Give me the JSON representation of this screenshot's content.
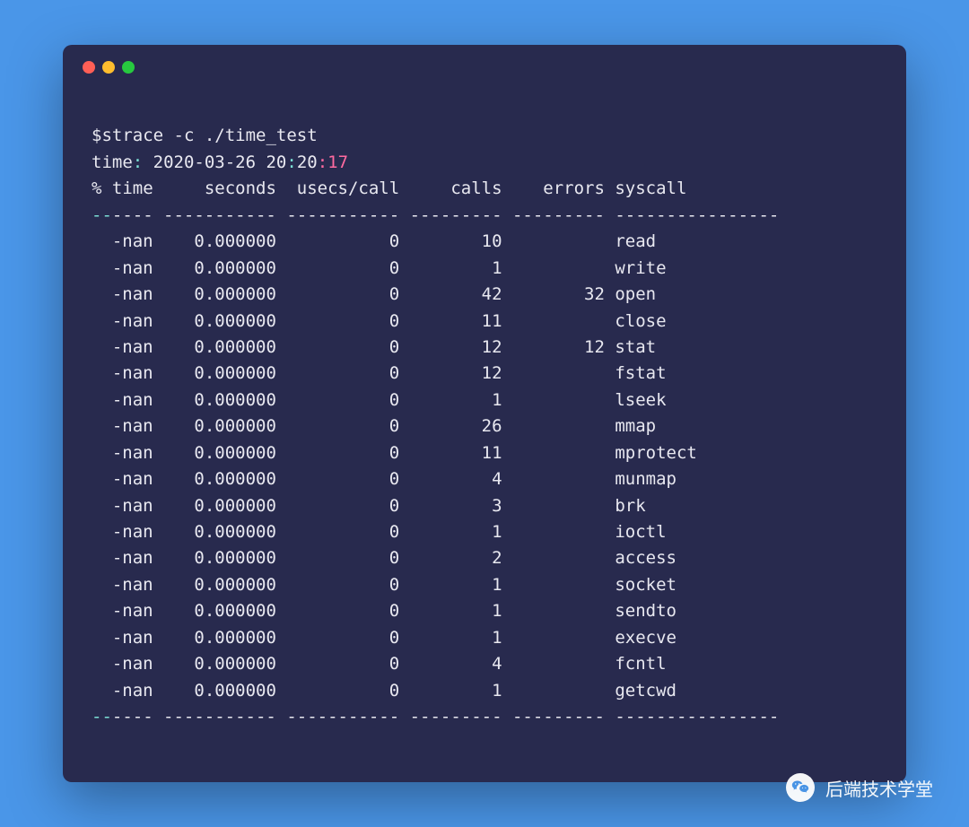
{
  "titlebar": {
    "dots": [
      "close",
      "minimize",
      "zoom"
    ]
  },
  "prompt": "$strace -c ./time_test",
  "time_label": "time",
  "time_sep1": ": ",
  "timestamp_date": "2020-03-26 20",
  "time_sep2": ":",
  "timestamp_min": "20",
  "time_sep3": ":",
  "timestamp_sec": "17",
  "columns": {
    "time": "% time",
    "seconds": "seconds",
    "usecs": "usecs/call",
    "calls": "calls",
    "errors": "errors",
    "syscall": "syscall"
  },
  "sep": {
    "time_c1": "--",
    "time_rest": "----",
    "seconds": "-----------",
    "usecs": "-----------",
    "calls": "---------",
    "errors": "---------",
    "syscall": "----------------"
  },
  "rows": [
    {
      "time": "-nan",
      "seconds": "0.000000",
      "usecs": "0",
      "calls": "10",
      "errors": "",
      "syscall": "read"
    },
    {
      "time": "-nan",
      "seconds": "0.000000",
      "usecs": "0",
      "calls": "1",
      "errors": "",
      "syscall": "write"
    },
    {
      "time": "-nan",
      "seconds": "0.000000",
      "usecs": "0",
      "calls": "42",
      "errors": "32",
      "syscall": "open"
    },
    {
      "time": "-nan",
      "seconds": "0.000000",
      "usecs": "0",
      "calls": "11",
      "errors": "",
      "syscall": "close"
    },
    {
      "time": "-nan",
      "seconds": "0.000000",
      "usecs": "0",
      "calls": "12",
      "errors": "12",
      "syscall": "stat"
    },
    {
      "time": "-nan",
      "seconds": "0.000000",
      "usecs": "0",
      "calls": "12",
      "errors": "",
      "syscall": "fstat"
    },
    {
      "time": "-nan",
      "seconds": "0.000000",
      "usecs": "0",
      "calls": "1",
      "errors": "",
      "syscall": "lseek"
    },
    {
      "time": "-nan",
      "seconds": "0.000000",
      "usecs": "0",
      "calls": "26",
      "errors": "",
      "syscall": "mmap"
    },
    {
      "time": "-nan",
      "seconds": "0.000000",
      "usecs": "0",
      "calls": "11",
      "errors": "",
      "syscall": "mprotect"
    },
    {
      "time": "-nan",
      "seconds": "0.000000",
      "usecs": "0",
      "calls": "4",
      "errors": "",
      "syscall": "munmap"
    },
    {
      "time": "-nan",
      "seconds": "0.000000",
      "usecs": "0",
      "calls": "3",
      "errors": "",
      "syscall": "brk"
    },
    {
      "time": "-nan",
      "seconds": "0.000000",
      "usecs": "0",
      "calls": "1",
      "errors": "",
      "syscall": "ioctl"
    },
    {
      "time": "-nan",
      "seconds": "0.000000",
      "usecs": "0",
      "calls": "2",
      "errors": "",
      "syscall": "access"
    },
    {
      "time": "-nan",
      "seconds": "0.000000",
      "usecs": "0",
      "calls": "1",
      "errors": "",
      "syscall": "socket"
    },
    {
      "time": "-nan",
      "seconds": "0.000000",
      "usecs": "0",
      "calls": "1",
      "errors": "",
      "syscall": "sendto"
    },
    {
      "time": "-nan",
      "seconds": "0.000000",
      "usecs": "0",
      "calls": "1",
      "errors": "",
      "syscall": "execve"
    },
    {
      "time": "-nan",
      "seconds": "0.000000",
      "usecs": "0",
      "calls": "4",
      "errors": "",
      "syscall": "fcntl"
    },
    {
      "time": "-nan",
      "seconds": "0.000000",
      "usecs": "0",
      "calls": "1",
      "errors": "",
      "syscall": "getcwd"
    }
  ],
  "watermark": {
    "text": "后端技术学堂"
  }
}
